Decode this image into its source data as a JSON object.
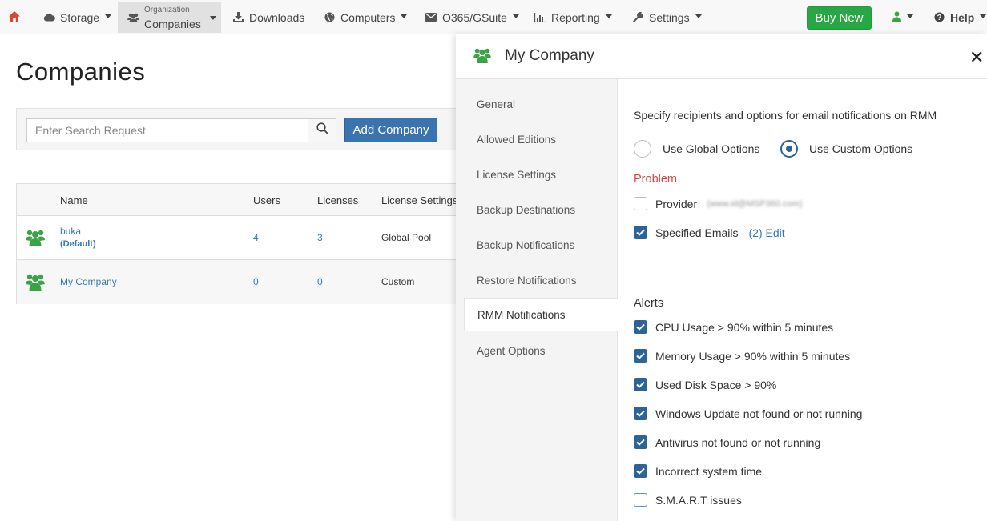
{
  "nav": {
    "storage": "Storage",
    "org_small": "Organization",
    "org_big": "Companies",
    "downloads": "Downloads",
    "computers": "Computers",
    "o365": "O365/GSuite",
    "reporting": "Reporting",
    "settings": "Settings",
    "buy_new": "Buy New",
    "help": "Help"
  },
  "page": {
    "title": "Companies",
    "search_placeholder": "Enter Search Request",
    "add_company": "Add Company"
  },
  "table": {
    "headers": [
      "Name",
      "Users",
      "Licenses",
      "License Settings"
    ],
    "rows": [
      {
        "name": "buka",
        "sub": "(Default)",
        "users": "4",
        "licenses": "3",
        "license_settings": "Global Pool"
      },
      {
        "name": "My Company",
        "sub": "",
        "users": "0",
        "licenses": "0",
        "license_settings": "Custom"
      }
    ]
  },
  "drawer": {
    "title": "My Company",
    "close": "✕",
    "menu": [
      "General",
      "Allowed Editions",
      "License Settings",
      "Backup Destinations",
      "Backup Notifications",
      "Restore Notifications",
      "RMM Notifications",
      "Agent Options"
    ],
    "active_menu": "RMM Notifications",
    "description": "Specify recipients and options for email notifications on RMM",
    "options": {
      "global": "Use Global Options",
      "custom": "Use Custom Options",
      "selected": "custom"
    },
    "problem": {
      "title": "Problem",
      "provider_label": "Provider",
      "provider_email": "(www.id@MSP360.com)",
      "provider_checked": false,
      "specified_label": "Specified Emails",
      "specified_link": "(2) Edit",
      "specified_checked": true
    },
    "alerts": {
      "title": "Alerts",
      "items": [
        {
          "label": "CPU Usage > 90% within 5 minutes",
          "checked": true
        },
        {
          "label": "Memory Usage > 90% within 5 minutes",
          "checked": true
        },
        {
          "label": "Used Disk Space > 90%",
          "checked": true
        },
        {
          "label": "Windows Update not found or not running",
          "checked": true
        },
        {
          "label": "Antivirus not found or not running",
          "checked": true
        },
        {
          "label": "Incorrect system time",
          "checked": true
        },
        {
          "label": "S.M.A.R.T issues",
          "checked": false
        }
      ]
    }
  },
  "colors": {
    "home_icon": "#d9443b",
    "buy_new": "#28a745",
    "primary": "#3a74b0",
    "company_icon": "#3aa345",
    "checkbox": "#2d6497",
    "problem": "#d9443b"
  }
}
